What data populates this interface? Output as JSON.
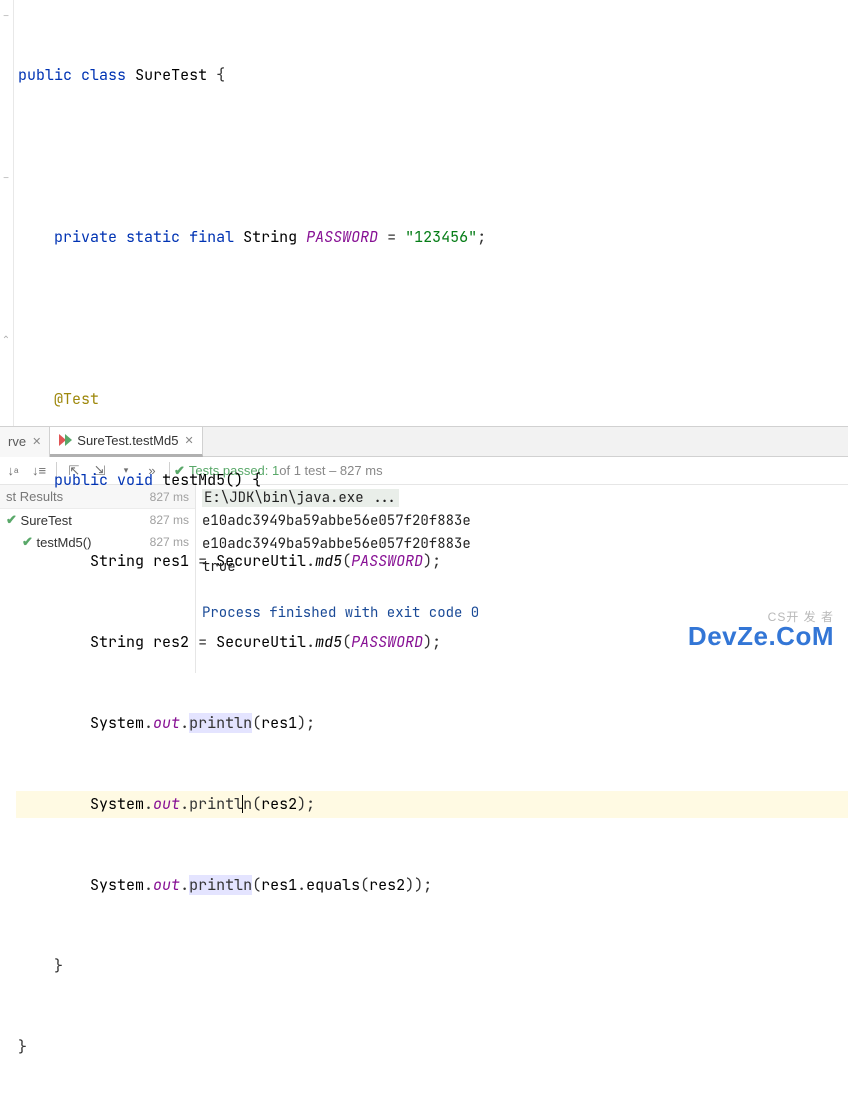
{
  "editor": {
    "class_name": "SureTest",
    "kw_public": "public",
    "kw_class": "class",
    "kw_private": "private",
    "kw_static": "static",
    "kw_final": "final",
    "kw_void": "void",
    "type_string": "String",
    "const_password": "PASSWORD",
    "const_value": "\"123456\"",
    "annotation_test": "@Test",
    "method_name": "testMd5",
    "var_res1": "res1",
    "var_res2": "res2",
    "secureutil": "SecureUtil",
    "md5": "md5",
    "system": "System",
    "out": "out",
    "println": "println",
    "equals": "equals"
  },
  "tabs": {
    "inactive_suffix": "rve",
    "active_label": "SureTest.testMd5"
  },
  "toolbar": {
    "tests_passed_prefix": "Tests passed: 1",
    "tests_passed_suffix": " of 1 test – 827 ms"
  },
  "tree": {
    "header": "st Results",
    "header_ms": "827 ms",
    "suite_name": "SureTest",
    "suite_ms": "827 ms",
    "test_name": "testMd5()",
    "test_ms": "827 ms"
  },
  "console": {
    "line1": "E:\\JDK\\bin\\java.exe ...",
    "line2": "e10adc3949ba59abbe56e057f20f883e",
    "line3": "e10adc3949ba59abbe56e057f20f883e",
    "line4": "true",
    "line5": "Process finished with exit code 0"
  },
  "watermark": {
    "small": "CS开 发 者",
    "big": "DevZe.CoM"
  }
}
